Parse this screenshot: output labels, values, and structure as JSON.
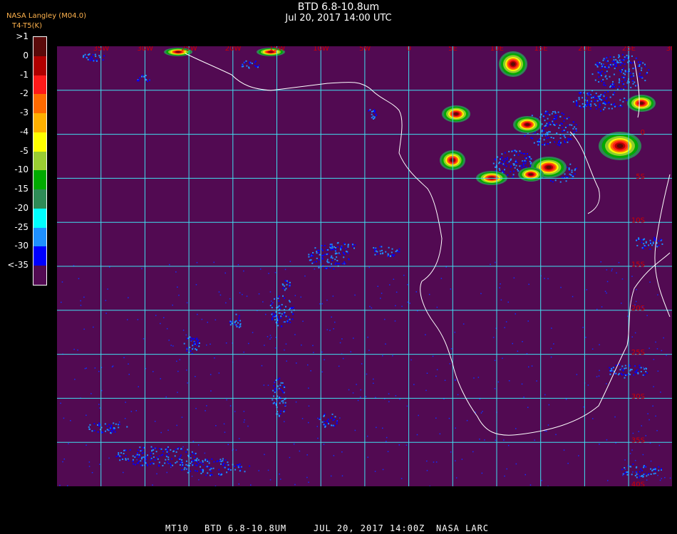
{
  "header": {
    "title": "BTD 6.8-10.8um",
    "subtitle": "Jul 20, 2017 14:00 UTC",
    "credit_line1": "NASA Langley (M04.0)",
    "credit_line2": "T4-T5(K)",
    "overlay_label": "BTD"
  },
  "legend": {
    "unit": "K",
    "items": [
      {
        "label": ">1",
        "color": "#5a0a0a"
      },
      {
        "label": "0",
        "color": "#b00000"
      },
      {
        "label": "-1",
        "color": "#ff1a1a"
      },
      {
        "label": "-2",
        "color": "#ff6a00"
      },
      {
        "label": "-3",
        "color": "#ffb000"
      },
      {
        "label": "-4",
        "color": "#ffff00"
      },
      {
        "label": "-5",
        "color": "#9acd32"
      },
      {
        "label": "-10",
        "color": "#00aa00"
      },
      {
        "label": "-15",
        "color": "#2e8b57"
      },
      {
        "label": "-20",
        "color": "#00ffff"
      },
      {
        "label": "-25",
        "color": "#1e90ff"
      },
      {
        "label": "-30",
        "color": "#0000ff"
      },
      {
        "label": "<-35",
        "color": "#520a52"
      }
    ]
  },
  "map": {
    "background": "#520a52",
    "grid_color": "#40e0f0",
    "coast_color": "#ffffff",
    "label_color": "#d00000",
    "lon_labels": [
      "35W",
      "30W",
      "25W",
      "20W",
      "15W",
      "10W",
      "5W",
      "0",
      "5E",
      "10E",
      "15E",
      "20E",
      "25E",
      "30E",
      "35E"
    ],
    "lat_labels": [
      "0",
      "5S",
      "10S",
      "15S",
      "20S",
      "25S",
      "30S",
      "35S",
      "40S"
    ]
  },
  "footer": {
    "product": "MT10",
    "band": "BTD 6.8-10.8UM",
    "datetime": "JUL 20, 2017 14:00Z",
    "source": "NASA LARC"
  }
}
